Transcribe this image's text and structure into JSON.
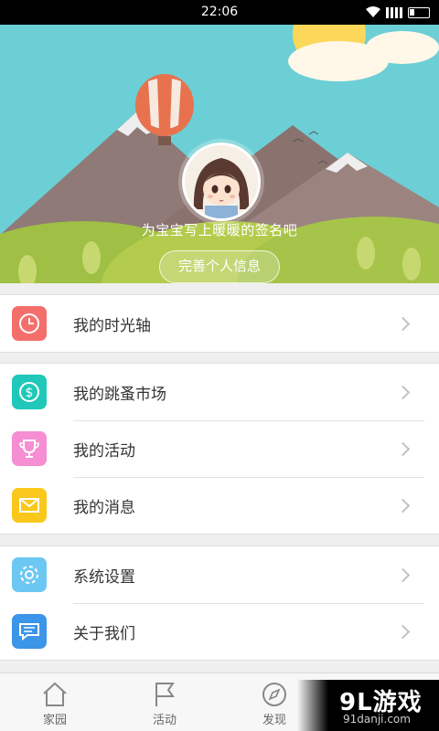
{
  "status_bar": {
    "time": "22:06"
  },
  "profile": {
    "signature": "为宝宝写上暖暖的签名吧",
    "complete_button": "完善个人信息"
  },
  "menu_groups": [
    {
      "items": [
        {
          "label": "我的时光轴",
          "icon": "clock-icon",
          "color": "#f46f6c"
        }
      ]
    },
    {
      "items": [
        {
          "label": "我的跳蚤市场",
          "icon": "dollar-icon",
          "color": "#1fc8b8"
        },
        {
          "label": "我的活动",
          "icon": "trophy-icon",
          "color": "#f58ed2"
        },
        {
          "label": "我的消息",
          "icon": "envelope-icon",
          "color": "#f9c81b"
        }
      ]
    },
    {
      "items": [
        {
          "label": "系统设置",
          "icon": "gear-icon",
          "color": "#6cc8f2"
        },
        {
          "label": "关于我们",
          "icon": "chat-icon",
          "color": "#3b95e8"
        }
      ]
    }
  ],
  "bottom_nav": [
    {
      "label": "家园",
      "icon": "home-icon"
    },
    {
      "label": "活动",
      "icon": "flag-icon"
    },
    {
      "label": "发现",
      "icon": "compass-icon"
    }
  ],
  "watermark": {
    "title": "9L游戏",
    "url": "91danji.com"
  }
}
